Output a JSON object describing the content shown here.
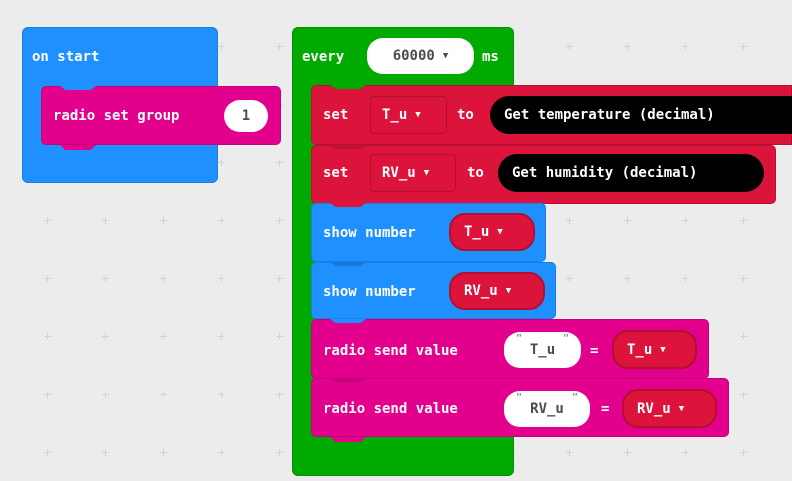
{
  "on_start": {
    "hat_label": "on start",
    "radio_set_group": {
      "label": "radio set group",
      "value": "1"
    }
  },
  "every": {
    "label": "every",
    "interval": "60000",
    "unit": "ms",
    "set_temp": {
      "set": "set",
      "var": "T_u",
      "to": "to",
      "value": "Get temperature (decimal)"
    },
    "set_hum": {
      "set": "set",
      "var": "RV_u",
      "to": "to",
      "value": "Get humidity (decimal)"
    },
    "show_t": {
      "label": "show number",
      "var": "T_u"
    },
    "show_rv": {
      "label": "show number",
      "var": "RV_u"
    },
    "send_t": {
      "label": "radio send value",
      "name": "T_u",
      "eq": "=",
      "var": "T_u"
    },
    "send_rv": {
      "label": "radio send value",
      "name": "RV_u",
      "eq": "=",
      "var": "RV_u"
    }
  },
  "glyphs": {
    "caret": "▼",
    "quote": "\""
  },
  "colors": {
    "background": "#ececec",
    "basic": "#1e90ff",
    "radio": "#e3008c",
    "variables": "#dc143c",
    "loops": "#00aa00",
    "sensor": "#000000"
  }
}
